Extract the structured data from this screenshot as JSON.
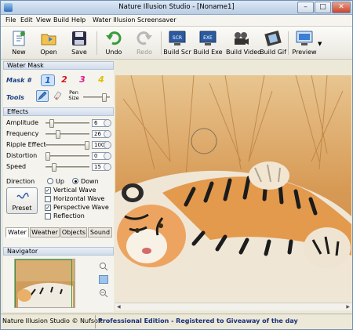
{
  "window": {
    "title": "Nature Illusion Studio - [Noname1]",
    "minimize": "–",
    "maximize": "□",
    "close": "✕"
  },
  "menu": [
    "File",
    "Edit",
    "View",
    "Build",
    "Help",
    "Water Illusion Screensaver"
  ],
  "toolbar": {
    "new": "New",
    "open": "Open",
    "save": "Save",
    "undo": "Undo",
    "redo": "Redo",
    "build_scr": "Build Scr",
    "build_exe": "Build Exe",
    "build_video": "Build Video",
    "build_gif": "Build Gif",
    "preview": "Preview",
    "scr_icon_text": "SCR",
    "exe_icon_text": "EXE"
  },
  "water_mask": {
    "header": "Water Mask",
    "mask_label": "Mask #",
    "masks": [
      "1",
      "2",
      "3",
      "4"
    ],
    "mask_colors": [
      "#1f5fd0",
      "#d81818",
      "#e01890",
      "#e0c000"
    ],
    "tools_label": "Tools",
    "pen_size_label": "Pen Size",
    "pen_size_level": 0.85
  },
  "effects": {
    "header": "Effects",
    "params": [
      {
        "label": "Amplitude",
        "value": "6",
        "level": 0.1
      },
      {
        "label": "Frequency",
        "value": "26",
        "level": 0.26
      },
      {
        "label": "Ripple Effect",
        "value": "100",
        "level": 1.0
      },
      {
        "label": "Distortion",
        "value": "0",
        "level": 0.0
      },
      {
        "label": "Speed",
        "value": "15",
        "level": 0.15
      }
    ],
    "direction_label": "Direction",
    "direction_up": "Up",
    "direction_down": "Down",
    "preset_label": "Preset",
    "options": [
      {
        "label": "Vertical Wave",
        "checked": true
      },
      {
        "label": "Horizontal Wave",
        "checked": false
      },
      {
        "label": "Perspective Wave",
        "checked": true
      },
      {
        "label": "Reflection",
        "checked": false
      }
    ]
  },
  "tabs": [
    "Water",
    "Weather",
    "Objects",
    "Sound"
  ],
  "navigator": {
    "header": "Navigator"
  },
  "status": {
    "left": "Nature Illusion Studio © Nufsoft",
    "right": "Professional Edition - Registered to Giveaway of the day"
  }
}
